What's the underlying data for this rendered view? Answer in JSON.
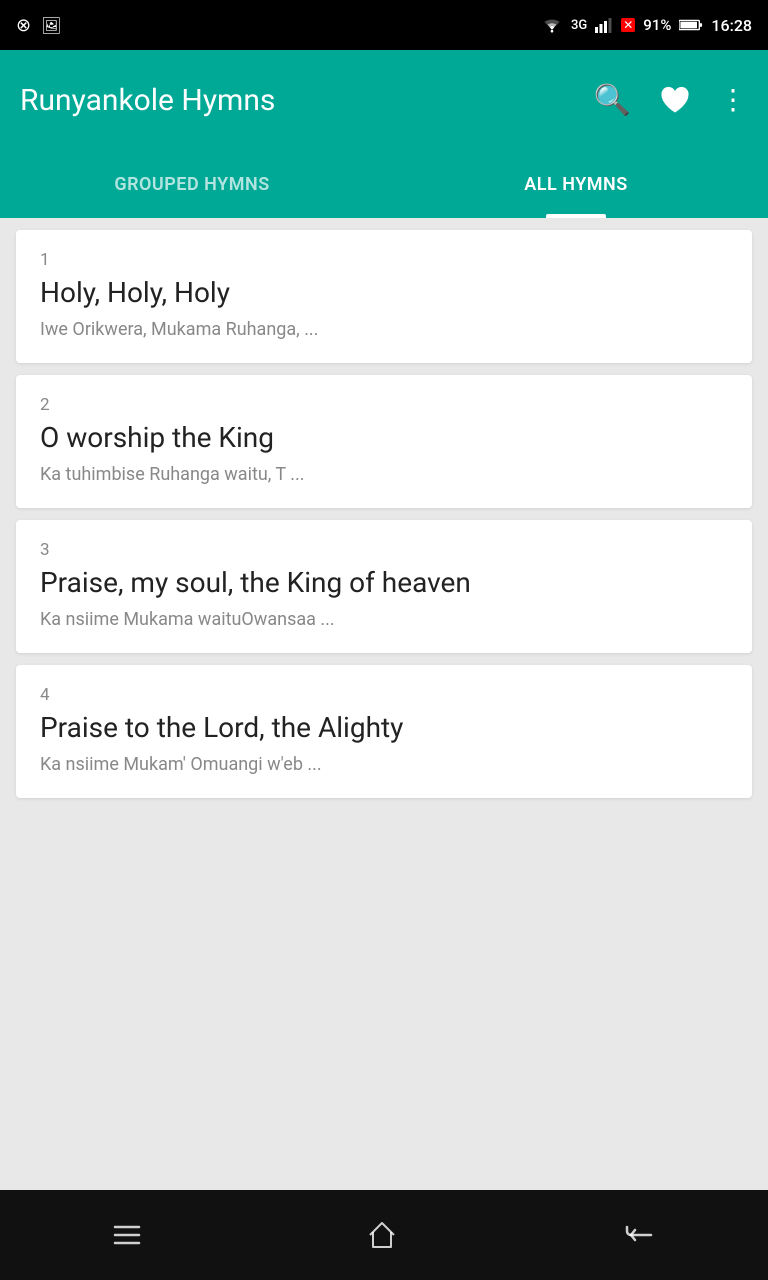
{
  "statusBar": {
    "leftIcons": [
      "8ball-icon",
      "image-icon"
    ],
    "wifi": "wifi-icon",
    "signal": "3G",
    "battery": "91%",
    "time": "16:28"
  },
  "appBar": {
    "title": "Runyankole Hymns",
    "searchIcon": "search-icon",
    "favoriteIcon": "heart-icon",
    "moreIcon": "more-vert-icon"
  },
  "tabs": [
    {
      "id": "grouped",
      "label": "GROUPED HYMNS",
      "active": false
    },
    {
      "id": "all",
      "label": "ALL HYMNS",
      "active": true
    }
  ],
  "hymns": [
    {
      "number": "1",
      "title": "Holy, Holy, Holy",
      "subtitle": "Iwe Orikwera, Mukama Ruhanga, ..."
    },
    {
      "number": "2",
      "title": "O worship the King",
      "subtitle": "Ka tuhimbise Ruhanga waitu, T ..."
    },
    {
      "number": "3",
      "title": "Praise, my soul, the King of heaven",
      "subtitle": "Ka nsiime Mukama waituOwansaa ..."
    },
    {
      "number": "4",
      "title": "Praise to the Lord, the Alighty",
      "subtitle": "Ka nsiime Mukam' Omuangi w'eb ..."
    }
  ],
  "bottomNav": {
    "menuIcon": "menu-icon",
    "homeIcon": "home-icon",
    "backIcon": "back-icon"
  }
}
